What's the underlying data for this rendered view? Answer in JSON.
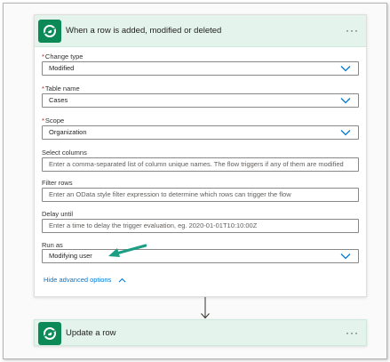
{
  "trigger": {
    "title": "When a row is added, modified or deleted",
    "more": "···",
    "fields": [
      {
        "label": "Change type",
        "required": true,
        "value": "Modified",
        "placeholder": "",
        "dropdown": true
      },
      {
        "label": "Table name",
        "required": true,
        "value": "Cases",
        "placeholder": "",
        "dropdown": true
      },
      {
        "label": "Scope",
        "required": true,
        "value": "Organization",
        "placeholder": "",
        "dropdown": true
      },
      {
        "label": "Select columns",
        "required": false,
        "value": "",
        "placeholder": "Enter a comma-separated list of column unique names. The flow triggers if any of them are modified",
        "dropdown": false
      },
      {
        "label": "Filter rows",
        "required": false,
        "value": "",
        "placeholder": "Enter an OData style filter expression to determine which rows can trigger the flow",
        "dropdown": false
      },
      {
        "label": "Delay until",
        "required": false,
        "value": "",
        "placeholder": "Enter a time to delay the trigger evaluation, eg. 2020-01-01T10:10:00Z",
        "dropdown": false
      },
      {
        "label": "Run as",
        "required": false,
        "value": "Modifying user",
        "placeholder": "",
        "dropdown": true
      }
    ],
    "advanced_link": "Hide advanced options"
  },
  "action": {
    "title": "Update a row",
    "more": "···"
  },
  "colors": {
    "header_bg": "#e4f3ec",
    "icon_bg": "#0b8a58",
    "link": "#0078d4",
    "chevron": "#0078d4",
    "required": "#a4262c",
    "annotation_arrow": "#1a9e84"
  },
  "icons": {
    "dataverse": "dataverse-logo-icon",
    "dropdown": "chevron-down-icon",
    "collapse": "chevron-up-icon",
    "connector": "arrow-down-icon"
  }
}
